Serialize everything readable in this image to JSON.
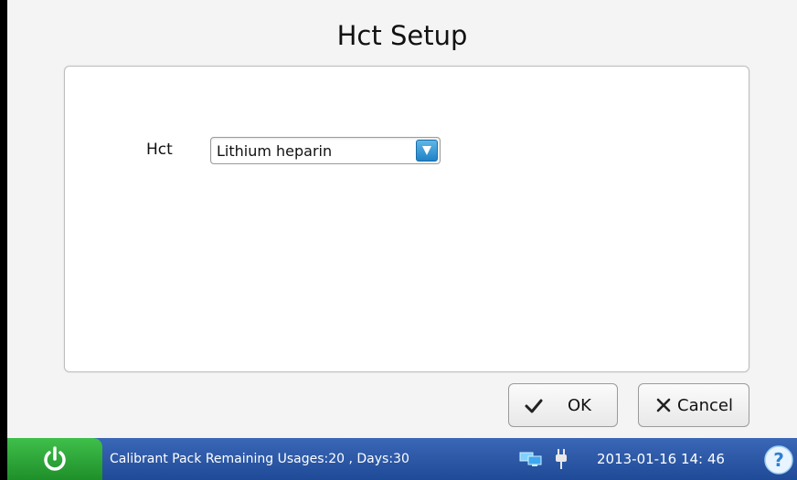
{
  "dialog": {
    "title": "Hct Setup",
    "field_label": "Hct",
    "select_value": "Lithium heparin",
    "ok_label": "OK",
    "cancel_label": "Cancel"
  },
  "statusbar": {
    "message": "Calibrant Pack Remaining Usages:20 , Days:30",
    "datetime": "2013-01-16 14: 46"
  },
  "icons": [
    "power-icon",
    "check-icon",
    "x-icon",
    "network-icon",
    "plug-icon",
    "help-icon",
    "dropdown-arrow-icon"
  ],
  "colors": {
    "statusbar": "#2a58a8",
    "power_button": "#2fa83a",
    "dropdown_arrow": "#2f96d4"
  }
}
